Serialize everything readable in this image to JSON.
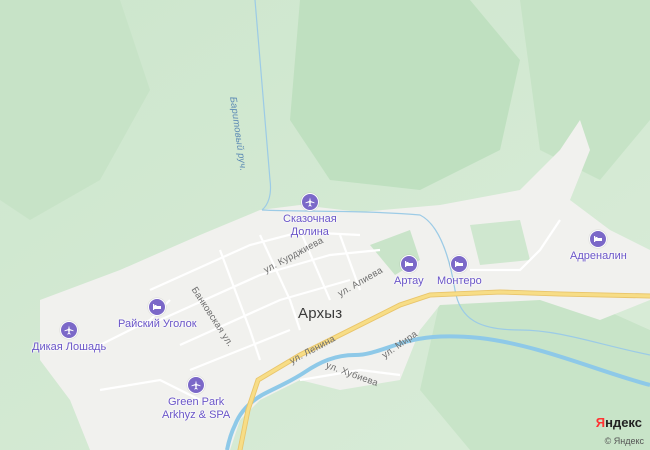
{
  "map": {
    "town": "Архыз",
    "stream": "Баритовый руч.",
    "streets": [
      "ул. Курджиева",
      "ул. Алиева",
      "Банковская ул.",
      "ул. Ленина",
      "ул. Мира",
      "ул. Хубиева"
    ],
    "pois": [
      {
        "name": "Сказочная\nДолина",
        "icon": "airplane-icon"
      },
      {
        "name": "Артау",
        "icon": "bed-icon"
      },
      {
        "name": "Монтеро",
        "icon": "bed-icon"
      },
      {
        "name": "Адреналин",
        "icon": "bed-icon"
      },
      {
        "name": "Райский Уголок",
        "icon": "bed-icon"
      },
      {
        "name": "Дикая Лошадь",
        "icon": "airplane-icon"
      },
      {
        "name": "Green Park\nArkhyz & SPA",
        "icon": "airplane-icon"
      }
    ]
  },
  "branding": {
    "logo": "Яндекс",
    "copyright": "© Яндекс"
  },
  "colors": {
    "forest": "#d4ead4",
    "forest_dark": "#b9dcba",
    "settlement": "#f1f1ee",
    "road_major": "#f5d97f",
    "water": "#8ec9e8",
    "poi": "#7b68c8"
  }
}
